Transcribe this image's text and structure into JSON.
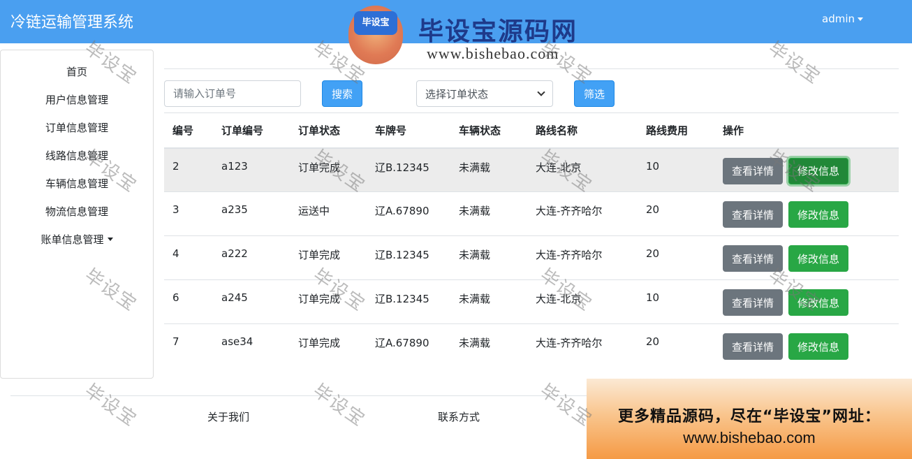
{
  "header": {
    "brand": "冷链运输管理系统",
    "user": "admin"
  },
  "watermark_logo": {
    "badge": "毕设宝",
    "title": "毕设宝源码网",
    "url": "www.bishebao.com"
  },
  "sidebar": {
    "items": [
      {
        "label": "首页"
      },
      {
        "label": "用户信息管理"
      },
      {
        "label": "订单信息管理"
      },
      {
        "label": "线路信息管理"
      },
      {
        "label": "车辆信息管理"
      },
      {
        "label": "物流信息管理"
      },
      {
        "label": "账单信息管理",
        "dropdown": true
      }
    ]
  },
  "filters": {
    "search_placeholder": "请输入订单号",
    "search_button": "搜索",
    "status_select": "选择订单状态",
    "filter_button": "筛选"
  },
  "table": {
    "headers": [
      "编号",
      "订单编号",
      "订单状态",
      "车牌号",
      "车辆状态",
      "路线名称",
      "路线费用",
      "操作"
    ],
    "rows": [
      {
        "id": "2",
        "order_no": "a123",
        "order_status": "订单完成",
        "plate": "辽B.12345",
        "vehicle_status": "未满载",
        "route": "大连-北京",
        "cost": "10"
      },
      {
        "id": "3",
        "order_no": "a235",
        "order_status": "运送中",
        "plate": "辽A.67890",
        "vehicle_status": "未满载",
        "route": "大连-齐齐哈尔",
        "cost": "20"
      },
      {
        "id": "4",
        "order_no": "a222",
        "order_status": "订单完成",
        "plate": "辽B.12345",
        "vehicle_status": "未满载",
        "route": "大连-齐齐哈尔",
        "cost": "20"
      },
      {
        "id": "6",
        "order_no": "a245",
        "order_status": "订单完成",
        "plate": "辽B.12345",
        "vehicle_status": "未满载",
        "route": "大连-北京",
        "cost": "10"
      },
      {
        "id": "7",
        "order_no": "ase34",
        "order_status": "订单完成",
        "plate": "辽A.67890",
        "vehicle_status": "未满载",
        "route": "大连-齐齐哈尔",
        "cost": "20"
      }
    ],
    "view_button": "查看详情",
    "edit_button": "修改信息"
  },
  "footer": {
    "about": "关于我们",
    "contact": "联系方式"
  },
  "ad": {
    "line1": "更多精品源码，尽在“毕设宝”网址：",
    "line2": "www.bishebao.com"
  },
  "watermark_text": "毕设宝",
  "colors": {
    "navbar": "#4a9ff0",
    "primary": "#42a1f5",
    "secondary": "#6c757d",
    "success": "#28a745"
  }
}
